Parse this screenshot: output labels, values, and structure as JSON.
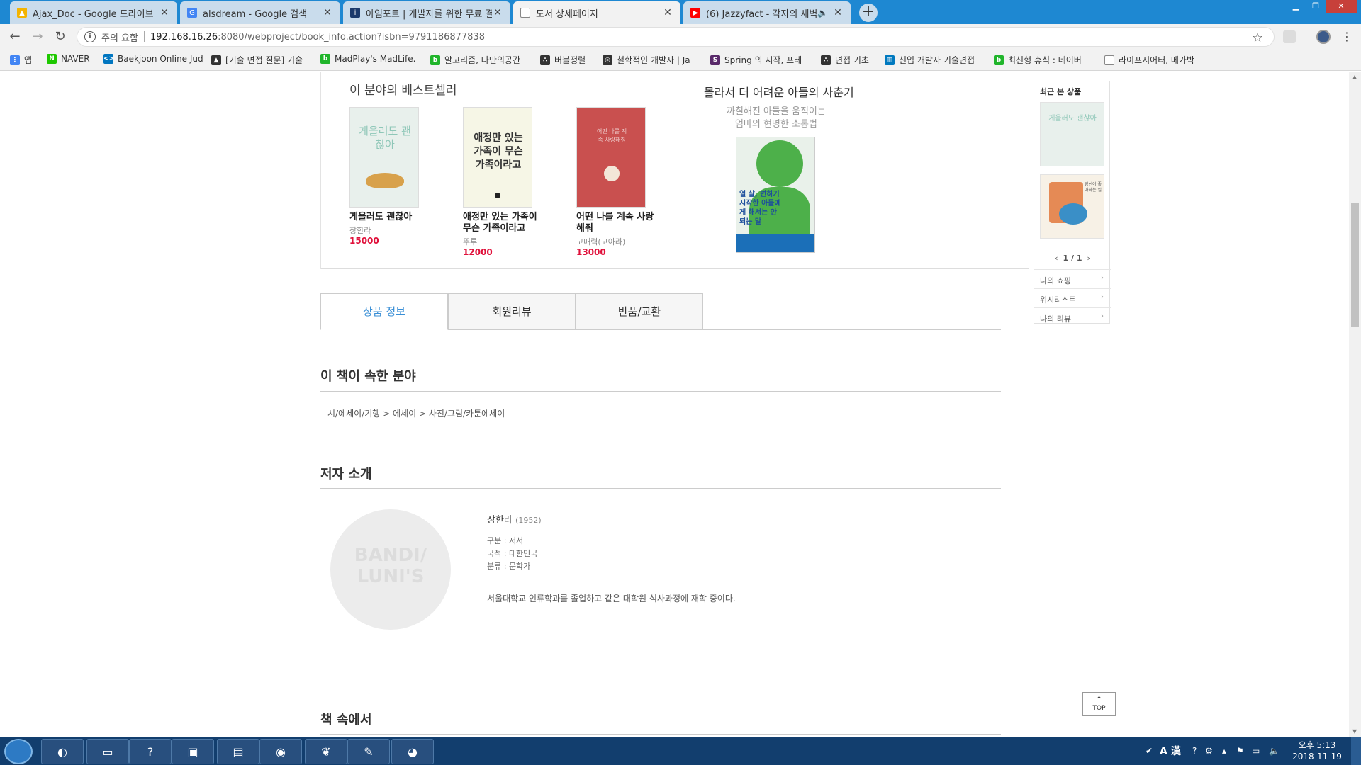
{
  "browser": {
    "tabs": [
      {
        "label": "Ajax_Doc - Google 드라이브",
        "icon": "google-drive-icon",
        "color": "#f4b400"
      },
      {
        "label": "alsdream - Google 검색",
        "icon": "google-icon",
        "color": "#4285f4"
      },
      {
        "label": "아임포트 | 개발자를 위한 무료 결",
        "icon": "iamport-icon",
        "color": "#1b3a6b"
      },
      {
        "label": "도서 상세페이지",
        "icon": "page-icon",
        "color": "#888888"
      },
      {
        "label": "(6) Jazzyfact - 각자의 새벽",
        "icon": "youtube-icon",
        "color": "#ff0000"
      }
    ],
    "address": {
      "security_warning": "주의 요함",
      "host": "192.168.16.26",
      "path": ":8080/webproject/book_info.action?isbn=9791186877838"
    },
    "bookmarks": [
      {
        "label": "앱",
        "icon": "apps-icon",
        "color": "#4285f4"
      },
      {
        "label": "NAVER",
        "icon": "naver-icon",
        "color": "#1ec800"
      },
      {
        "label": "Baekjoon Online Jud",
        "icon": "code-icon",
        "color": "#0076c0"
      },
      {
        "label": "[기술 면접 질문] 기술",
        "icon": "penguin-icon",
        "color": "#333333"
      },
      {
        "label": "MadPlay's MadLife.",
        "icon": "blog-icon",
        "color": "#20b52b"
      },
      {
        "label": "알고리즘, 나만의공간",
        "icon": "blog-icon",
        "color": "#20b52b"
      },
      {
        "label": "버블정렬",
        "icon": "dots-icon",
        "color": "#333333"
      },
      {
        "label": "철학적인 개발자 | Ja",
        "icon": "ghost-icon",
        "color": "#333333"
      },
      {
        "label": "Spring 의 시작, 프레",
        "icon": "spring-icon",
        "color": "#5a2a6b"
      },
      {
        "label": "면접 기초",
        "icon": "dots-icon",
        "color": "#333333"
      },
      {
        "label": "신입 개발자 기술면접",
        "icon": "trello-icon",
        "color": "#0079bf"
      },
      {
        "label": "최신형 휴식 : 네이버",
        "icon": "blog-icon",
        "color": "#20b52b"
      },
      {
        "label": "라이프시어터, 메가박",
        "icon": "page-icon",
        "color": "#888888"
      }
    ]
  },
  "bestseller": {
    "title": "이 분야의 베스트셀러",
    "books": [
      {
        "title": "게을러도 괜찮아",
        "author": "장한라",
        "price": "15000",
        "cover_bg": "#e8f0ec",
        "cover_text": "게을러도 괜찮아"
      },
      {
        "title": "애정만 있는 가족이 무슨 가족이라고",
        "author": "뚜루",
        "price": "12000",
        "cover_bg": "#f6f6e6",
        "cover_text": "애정만 있는 가족이 무슨 가족이라고"
      },
      {
        "title": "어떤 나를 계속 사랑해줘",
        "author": "고매력(고아라)",
        "price": "13000",
        "cover_bg": "#c9504f",
        "cover_text": "어떤 나를 계속 사랑해줘"
      }
    ]
  },
  "banner": {
    "title": "몰라서 더 어려운 아들의 사춘기",
    "subtitle_line1": "까칠해진 아들을 움직이는",
    "subtitle_line2": "엄마의 현명한 소통법",
    "book_text": "열 살, 변하기 시작한 아들에게 해서는 안 되는 말"
  },
  "recent": {
    "title": "최근 본 상품",
    "pager": "1 / 1",
    "links": [
      "나의 쇼핑",
      "위시리스트",
      "나의 리뷰"
    ],
    "thumb1_text": "게을러도 괜찮아",
    "thumb2_text": "당신이 좋아하는 일"
  },
  "product_tabs": [
    "상품 정보",
    "회원리뷰",
    "반품/교환"
  ],
  "category": {
    "heading": "이 책이 속한 분야",
    "path": "시/에세이/기행 > 에세이 > 사진/그림/카툰에세이"
  },
  "author": {
    "heading": "저자 소개",
    "photo_text_1": "BANDI/",
    "photo_text_2": "LUNI'S",
    "name": "장한라",
    "year": "(1952)",
    "meta": [
      "구분 : 저서",
      "국적 : 대한민국",
      "분류 : 문학가"
    ],
    "description": "서울대학교 인류학과를 졸업하고 같은 대학원 석사과정에 재학 중이다."
  },
  "inside_heading": "책 속에서",
  "top_button": "TOP",
  "taskbar": {
    "time": "오후 5:13",
    "date": "2018-11-19",
    "ime": "A 漢"
  }
}
